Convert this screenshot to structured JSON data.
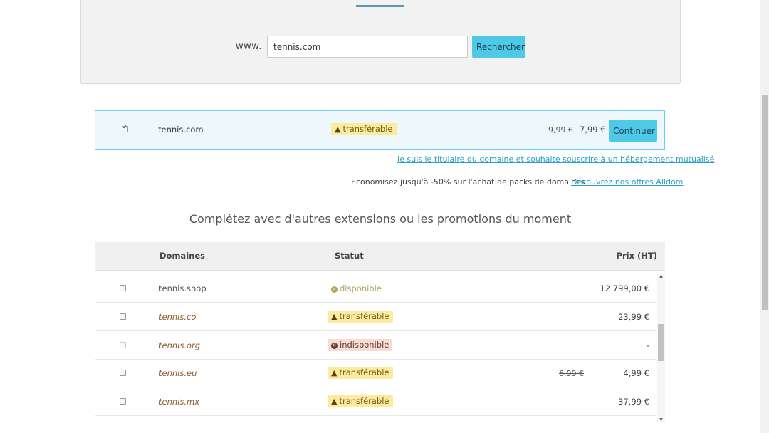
{
  "search": {
    "prefix": "www.",
    "value": "tennis.com",
    "button_label": "Rechercher"
  },
  "selected": {
    "checked": true,
    "domain": "tennis.com",
    "status": "transférable",
    "old_price": "9,99 €",
    "price": "7,99 €",
    "continue_label": "Continuer"
  },
  "hosting_link": "Je suis le titulaire du domaine et souhaite souscrire à un hébergement mutualisé",
  "promo": {
    "text": "Economisez jusqu'à -50% sur l'achat de packs de domaines",
    "link": "Découvrez nos offres Alldom"
  },
  "section_title": "Complétez avec d'autres extensions ou les promotions du moment",
  "table": {
    "headers": {
      "domains": "Domaines",
      "status": "Statut",
      "price": "Prix (HT)"
    },
    "rows": [
      {
        "domain": "tennis.shop",
        "status": "disponible",
        "status_type": "ok",
        "old_price": "",
        "price": "12 799,00 €"
      },
      {
        "domain": "tennis.co",
        "status": "transférable",
        "status_type": "warn",
        "old_price": "",
        "price": "23,99 €"
      },
      {
        "domain": "tennis.org",
        "status": "indisponible",
        "status_type": "no",
        "old_price": "",
        "price": "-"
      },
      {
        "domain": "tennis.eu",
        "status": "transférable",
        "status_type": "warn",
        "old_price": "6,99 €",
        "price": "4,99 €"
      },
      {
        "domain": "tennis.mx",
        "status": "transférable",
        "status_type": "warn",
        "old_price": "",
        "price": "37,99 €"
      }
    ]
  },
  "colors": {
    "accent": "#4ec9e8",
    "transfer_badge": "#fbeba0",
    "unavailable_badge": "#f5ddd6",
    "link": "#2aa0c8"
  }
}
